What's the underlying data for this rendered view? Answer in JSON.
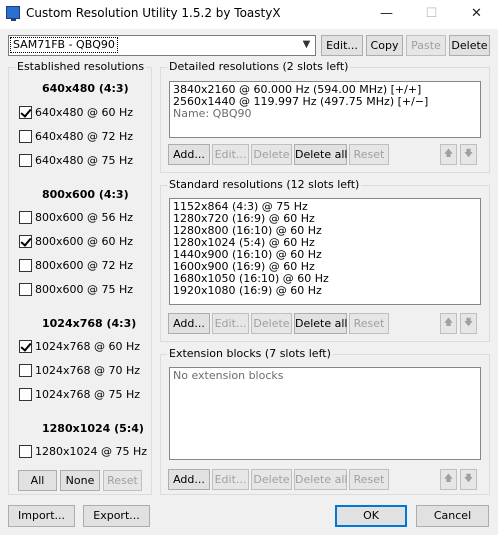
{
  "window": {
    "title": "Custom Resolution Utility 1.5.2 by ToastyX",
    "minimize": "—",
    "maximize": "☐",
    "close": "✕"
  },
  "monitor": {
    "selected": "SAM71FB - QBQ90",
    "edit_label": "Edit...",
    "copy_label": "Copy",
    "paste_label": "Paste",
    "delete_label": "Delete"
  },
  "established": {
    "title": "Established resolutions",
    "groups": [
      {
        "header": "640x480 (4:3)",
        "items": [
          {
            "label": "640x480 @ 60 Hz",
            "checked": true
          },
          {
            "label": "640x480 @ 72 Hz",
            "checked": false
          },
          {
            "label": "640x480 @ 75 Hz",
            "checked": false
          }
        ]
      },
      {
        "header": "800x600 (4:3)",
        "items": [
          {
            "label": "800x600 @ 56 Hz",
            "checked": false
          },
          {
            "label": "800x600 @ 60 Hz",
            "checked": true
          },
          {
            "label": "800x600 @ 72 Hz",
            "checked": false
          },
          {
            "label": "800x600 @ 75 Hz",
            "checked": false
          }
        ]
      },
      {
        "header": "1024x768 (4:3)",
        "items": [
          {
            "label": "1024x768 @ 60 Hz",
            "checked": true
          },
          {
            "label": "1024x768 @ 70 Hz",
            "checked": false
          },
          {
            "label": "1024x768 @ 75 Hz",
            "checked": false
          }
        ]
      },
      {
        "header": "1280x1024 (5:4)",
        "items": [
          {
            "label": "1280x1024 @ 75 Hz",
            "checked": false
          }
        ]
      }
    ],
    "all_label": "All",
    "none_label": "None",
    "reset_label": "Reset"
  },
  "detailed": {
    "title": "Detailed resolutions (2 slots left)",
    "lines": [
      "3840x2160 @ 60.000 Hz (594.00 MHz) [+/+]",
      "2560x1440 @ 119.997 Hz (497.75 MHz) [+/−]"
    ],
    "name_line": "Name: QBQ90"
  },
  "standard": {
    "title": "Standard resolutions (12 slots left)",
    "lines": [
      "1152x864 (4:3) @ 75 Hz",
      "1280x720 (16:9) @ 60 Hz",
      "1280x800 (16:10) @ 60 Hz",
      "1280x1024 (5:4) @ 60 Hz",
      "1440x900 (16:10) @ 60 Hz",
      "1600x900 (16:9) @ 60 Hz",
      "1680x1050 (16:10) @ 60 Hz",
      "1920x1080 (16:9) @ 60 Hz"
    ]
  },
  "extension": {
    "title": "Extension blocks (7 slots left)",
    "empty_text": "No extension blocks"
  },
  "list_buttons": {
    "add": "Add...",
    "edit": "Edit...",
    "delete": "Delete",
    "delete_all": "Delete all",
    "reset": "Reset",
    "up_icon": "🡅",
    "down_icon": "🡇"
  },
  "footer": {
    "import_label": "Import...",
    "export_label": "Export...",
    "ok_label": "OK",
    "cancel_label": "Cancel"
  }
}
